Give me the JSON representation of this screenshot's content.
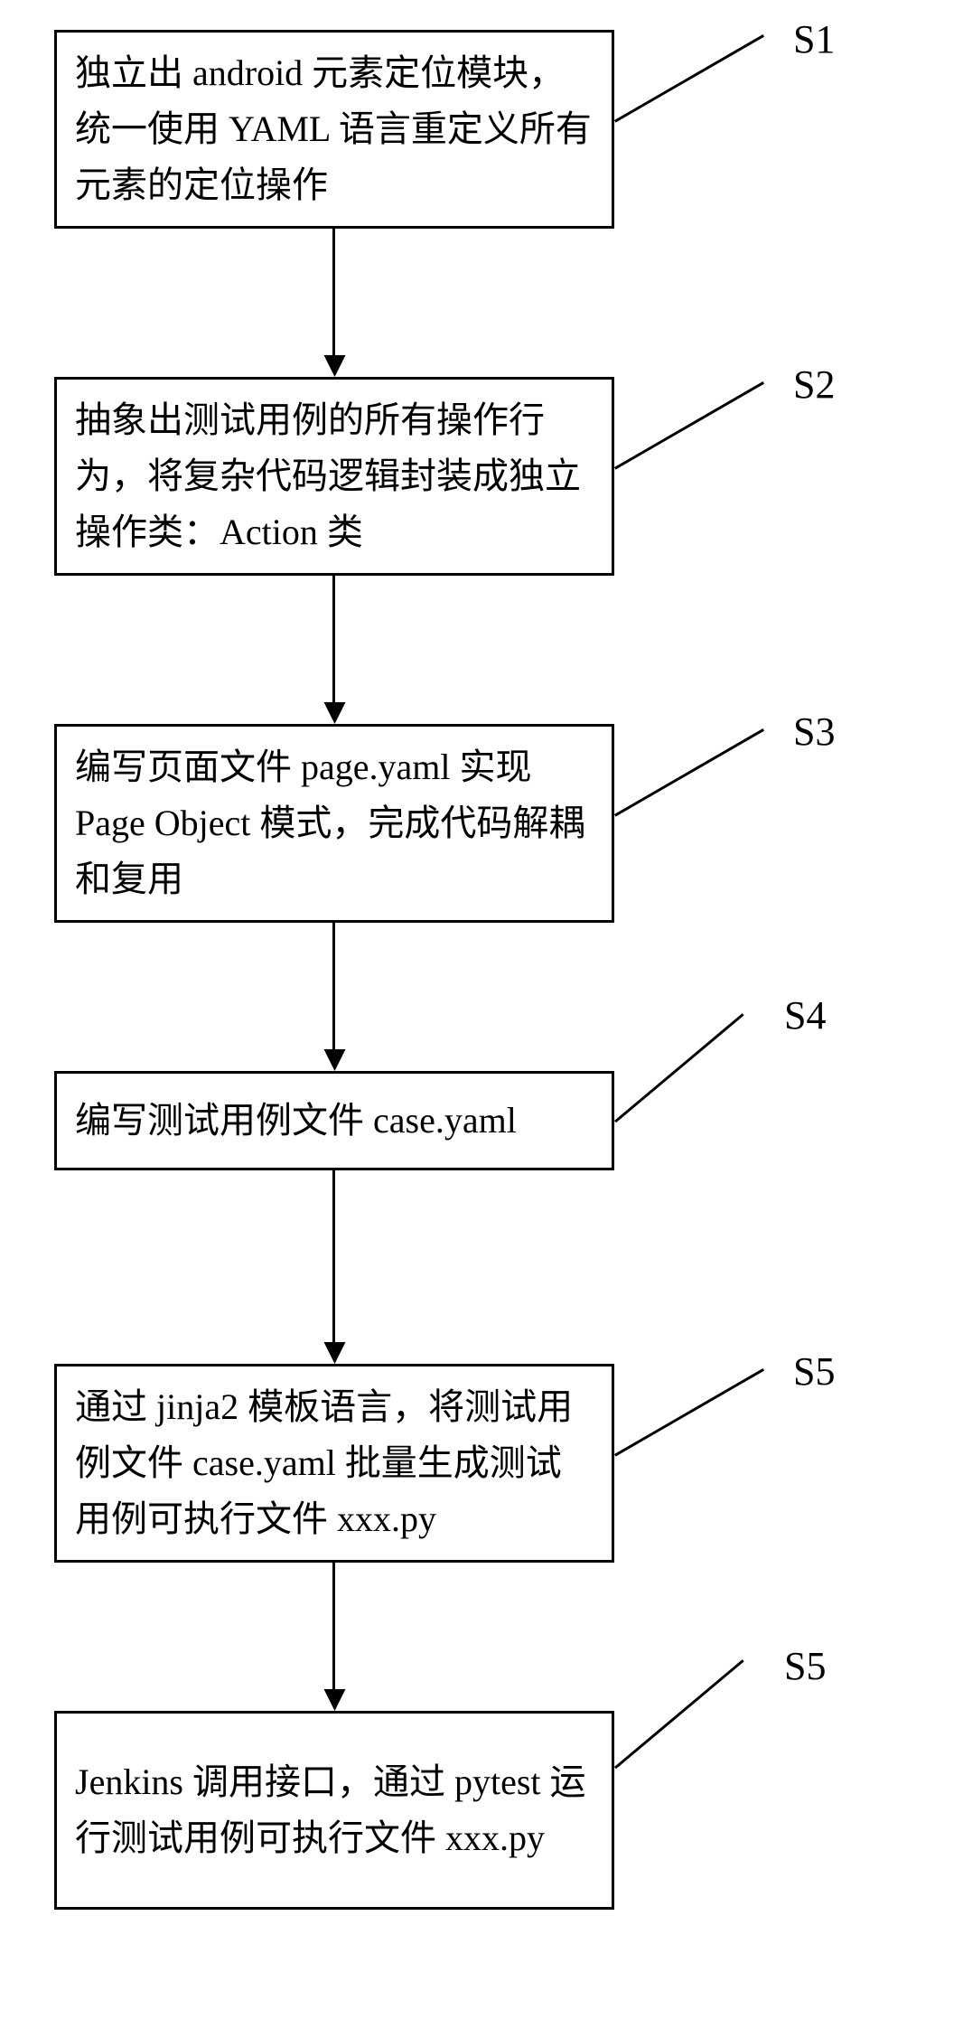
{
  "chart_data": {
    "type": "flowchart",
    "direction": "top-to-bottom",
    "nodes": [
      {
        "id": "S1",
        "label": "S1",
        "text": "独立出 android 元素定位模块，统一使用 YAML 语言重定义所有元素的定位操作"
      },
      {
        "id": "S2",
        "label": "S2",
        "text": "抽象出测试用例的所有操作行为，将复杂代码逻辑封装成独立操作类：Action 类"
      },
      {
        "id": "S3",
        "label": "S3",
        "text": "编写页面文件 page.yaml 实现 Page Object 模式，完成代码解耦和复用"
      },
      {
        "id": "S4",
        "label": "S4",
        "text": "编写测试用例文件 case.yaml"
      },
      {
        "id": "S5",
        "label": "S5",
        "text": "通过 jinja2 模板语言，将测试用例文件 case.yaml 批量生成测试用例可执行文件 xxx.py"
      },
      {
        "id": "S6",
        "label": "S5",
        "text": "Jenkins 调用接口，通过 pytest 运行测试用例可执行文件 xxx.py"
      }
    ],
    "edges": [
      {
        "from": "S1",
        "to": "S2"
      },
      {
        "from": "S2",
        "to": "S3"
      },
      {
        "from": "S3",
        "to": "S4"
      },
      {
        "from": "S4",
        "to": "S5"
      },
      {
        "from": "S5",
        "to": "S6"
      }
    ]
  }
}
